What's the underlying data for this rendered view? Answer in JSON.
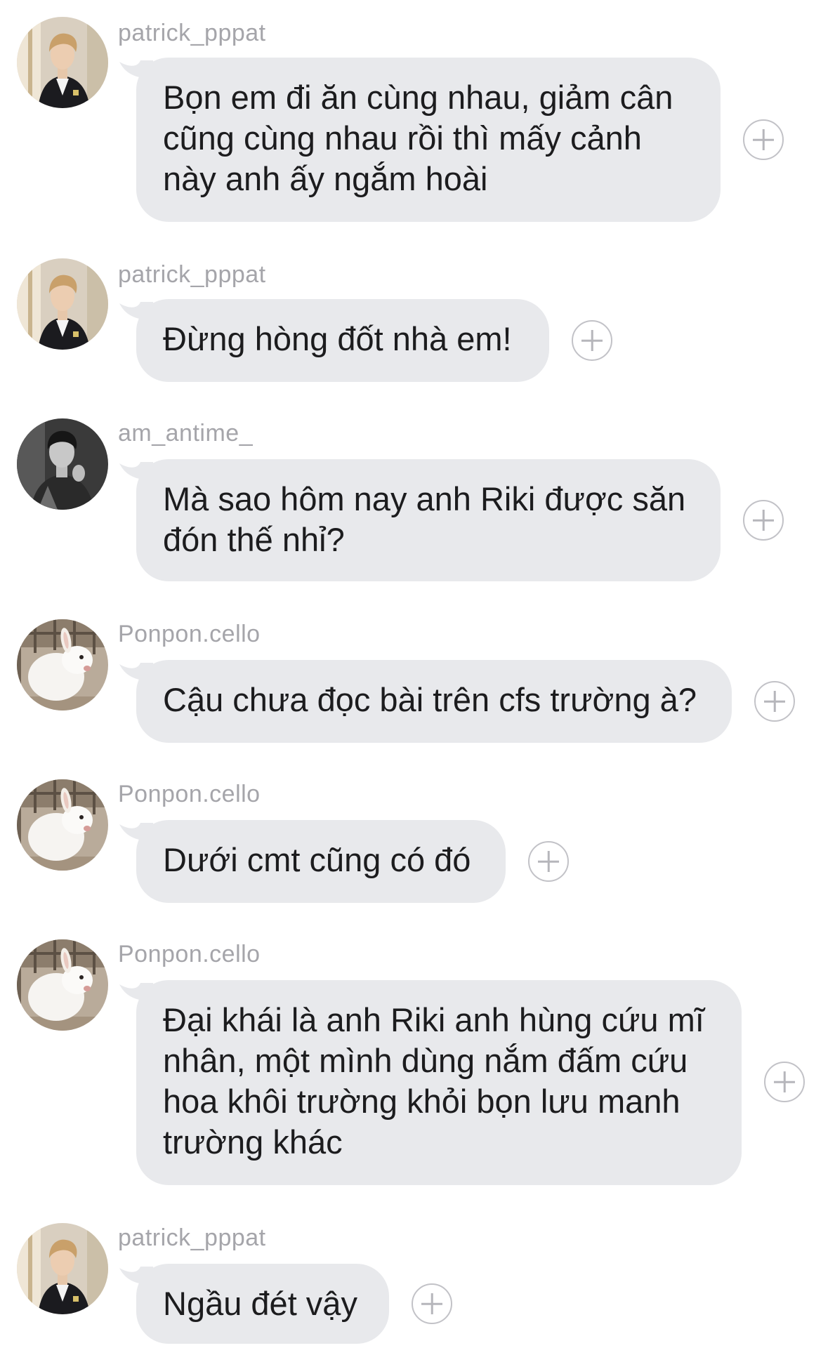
{
  "messages": [
    {
      "username": "patrick_pppat",
      "avatar": "man-portrait-avatar",
      "text": "Bọn em đi ăn cùng nhau, giảm cân\ncũng cùng nhau rồi thì mấy cảnh\nnày anh ấy ngắm hoài"
    },
    {
      "username": "patrick_pppat",
      "avatar": "man-portrait-avatar",
      "text": "Đừng hòng đốt nhà em!"
    },
    {
      "username": "am_antime_",
      "avatar": "man-bw-portrait-avatar",
      "text": "Mà sao hôm nay anh Riki được săn\nđón thế nhỉ?"
    },
    {
      "username": "Ponpon.cello",
      "avatar": "white-rabbit-avatar",
      "text": "Cậu chưa đọc bài trên cfs trường à?"
    },
    {
      "username": "Ponpon.cello",
      "avatar": "white-rabbit-avatar",
      "text": "Dưới cmt cũng có đó"
    },
    {
      "username": "Ponpon.cello",
      "avatar": "white-rabbit-avatar",
      "text": "Đại khái là anh Riki anh hùng cứu mĩ\nnhân, một mình dùng nắm đấm cứu\nhoa khôi trường khỏi bọn lưu manh\ntrường khác"
    },
    {
      "username": "patrick_pppat",
      "avatar": "man-portrait-avatar",
      "text": "Ngầu đét vậy"
    }
  ],
  "icons": {
    "add": "add-circle-icon"
  },
  "colors": {
    "bubble": "#e8e9ec",
    "username": "#a5a5aa",
    "text": "#1c1c1e",
    "add_icon": "#c2c2c7"
  }
}
